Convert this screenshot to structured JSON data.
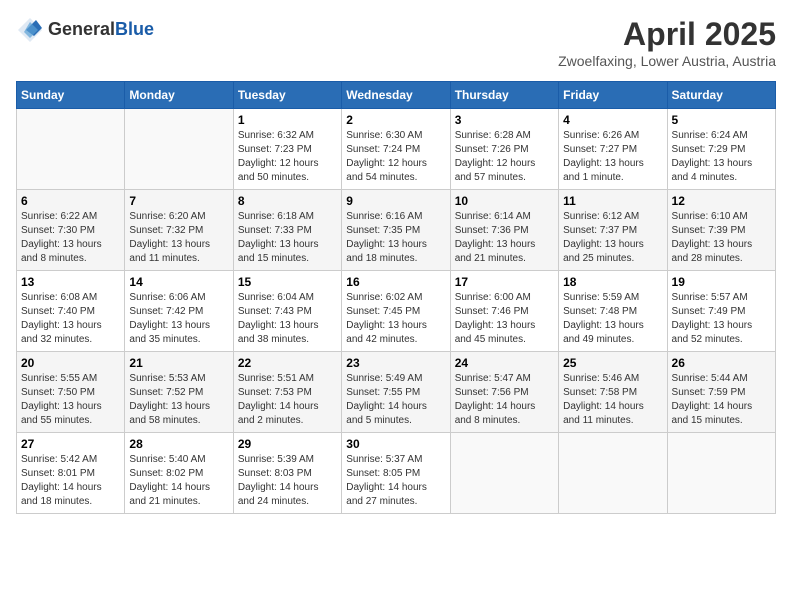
{
  "header": {
    "logo_line1": "General",
    "logo_line2": "Blue",
    "title": "April 2025",
    "subtitle": "Zwoelfaxing, Lower Austria, Austria"
  },
  "weekdays": [
    "Sunday",
    "Monday",
    "Tuesday",
    "Wednesday",
    "Thursday",
    "Friday",
    "Saturday"
  ],
  "weeks": [
    [
      {
        "day": "",
        "detail": ""
      },
      {
        "day": "",
        "detail": ""
      },
      {
        "day": "1",
        "detail": "Sunrise: 6:32 AM\nSunset: 7:23 PM\nDaylight: 12 hours\nand 50 minutes."
      },
      {
        "day": "2",
        "detail": "Sunrise: 6:30 AM\nSunset: 7:24 PM\nDaylight: 12 hours\nand 54 minutes."
      },
      {
        "day": "3",
        "detail": "Sunrise: 6:28 AM\nSunset: 7:26 PM\nDaylight: 12 hours\nand 57 minutes."
      },
      {
        "day": "4",
        "detail": "Sunrise: 6:26 AM\nSunset: 7:27 PM\nDaylight: 13 hours\nand 1 minute."
      },
      {
        "day": "5",
        "detail": "Sunrise: 6:24 AM\nSunset: 7:29 PM\nDaylight: 13 hours\nand 4 minutes."
      }
    ],
    [
      {
        "day": "6",
        "detail": "Sunrise: 6:22 AM\nSunset: 7:30 PM\nDaylight: 13 hours\nand 8 minutes."
      },
      {
        "day": "7",
        "detail": "Sunrise: 6:20 AM\nSunset: 7:32 PM\nDaylight: 13 hours\nand 11 minutes."
      },
      {
        "day": "8",
        "detail": "Sunrise: 6:18 AM\nSunset: 7:33 PM\nDaylight: 13 hours\nand 15 minutes."
      },
      {
        "day": "9",
        "detail": "Sunrise: 6:16 AM\nSunset: 7:35 PM\nDaylight: 13 hours\nand 18 minutes."
      },
      {
        "day": "10",
        "detail": "Sunrise: 6:14 AM\nSunset: 7:36 PM\nDaylight: 13 hours\nand 21 minutes."
      },
      {
        "day": "11",
        "detail": "Sunrise: 6:12 AM\nSunset: 7:37 PM\nDaylight: 13 hours\nand 25 minutes."
      },
      {
        "day": "12",
        "detail": "Sunrise: 6:10 AM\nSunset: 7:39 PM\nDaylight: 13 hours\nand 28 minutes."
      }
    ],
    [
      {
        "day": "13",
        "detail": "Sunrise: 6:08 AM\nSunset: 7:40 PM\nDaylight: 13 hours\nand 32 minutes."
      },
      {
        "day": "14",
        "detail": "Sunrise: 6:06 AM\nSunset: 7:42 PM\nDaylight: 13 hours\nand 35 minutes."
      },
      {
        "day": "15",
        "detail": "Sunrise: 6:04 AM\nSunset: 7:43 PM\nDaylight: 13 hours\nand 38 minutes."
      },
      {
        "day": "16",
        "detail": "Sunrise: 6:02 AM\nSunset: 7:45 PM\nDaylight: 13 hours\nand 42 minutes."
      },
      {
        "day": "17",
        "detail": "Sunrise: 6:00 AM\nSunset: 7:46 PM\nDaylight: 13 hours\nand 45 minutes."
      },
      {
        "day": "18",
        "detail": "Sunrise: 5:59 AM\nSunset: 7:48 PM\nDaylight: 13 hours\nand 49 minutes."
      },
      {
        "day": "19",
        "detail": "Sunrise: 5:57 AM\nSunset: 7:49 PM\nDaylight: 13 hours\nand 52 minutes."
      }
    ],
    [
      {
        "day": "20",
        "detail": "Sunrise: 5:55 AM\nSunset: 7:50 PM\nDaylight: 13 hours\nand 55 minutes."
      },
      {
        "day": "21",
        "detail": "Sunrise: 5:53 AM\nSunset: 7:52 PM\nDaylight: 13 hours\nand 58 minutes."
      },
      {
        "day": "22",
        "detail": "Sunrise: 5:51 AM\nSunset: 7:53 PM\nDaylight: 14 hours\nand 2 minutes."
      },
      {
        "day": "23",
        "detail": "Sunrise: 5:49 AM\nSunset: 7:55 PM\nDaylight: 14 hours\nand 5 minutes."
      },
      {
        "day": "24",
        "detail": "Sunrise: 5:47 AM\nSunset: 7:56 PM\nDaylight: 14 hours\nand 8 minutes."
      },
      {
        "day": "25",
        "detail": "Sunrise: 5:46 AM\nSunset: 7:58 PM\nDaylight: 14 hours\nand 11 minutes."
      },
      {
        "day": "26",
        "detail": "Sunrise: 5:44 AM\nSunset: 7:59 PM\nDaylight: 14 hours\nand 15 minutes."
      }
    ],
    [
      {
        "day": "27",
        "detail": "Sunrise: 5:42 AM\nSunset: 8:01 PM\nDaylight: 14 hours\nand 18 minutes."
      },
      {
        "day": "28",
        "detail": "Sunrise: 5:40 AM\nSunset: 8:02 PM\nDaylight: 14 hours\nand 21 minutes."
      },
      {
        "day": "29",
        "detail": "Sunrise: 5:39 AM\nSunset: 8:03 PM\nDaylight: 14 hours\nand 24 minutes."
      },
      {
        "day": "30",
        "detail": "Sunrise: 5:37 AM\nSunset: 8:05 PM\nDaylight: 14 hours\nand 27 minutes."
      },
      {
        "day": "",
        "detail": ""
      },
      {
        "day": "",
        "detail": ""
      },
      {
        "day": "",
        "detail": ""
      }
    ]
  ]
}
